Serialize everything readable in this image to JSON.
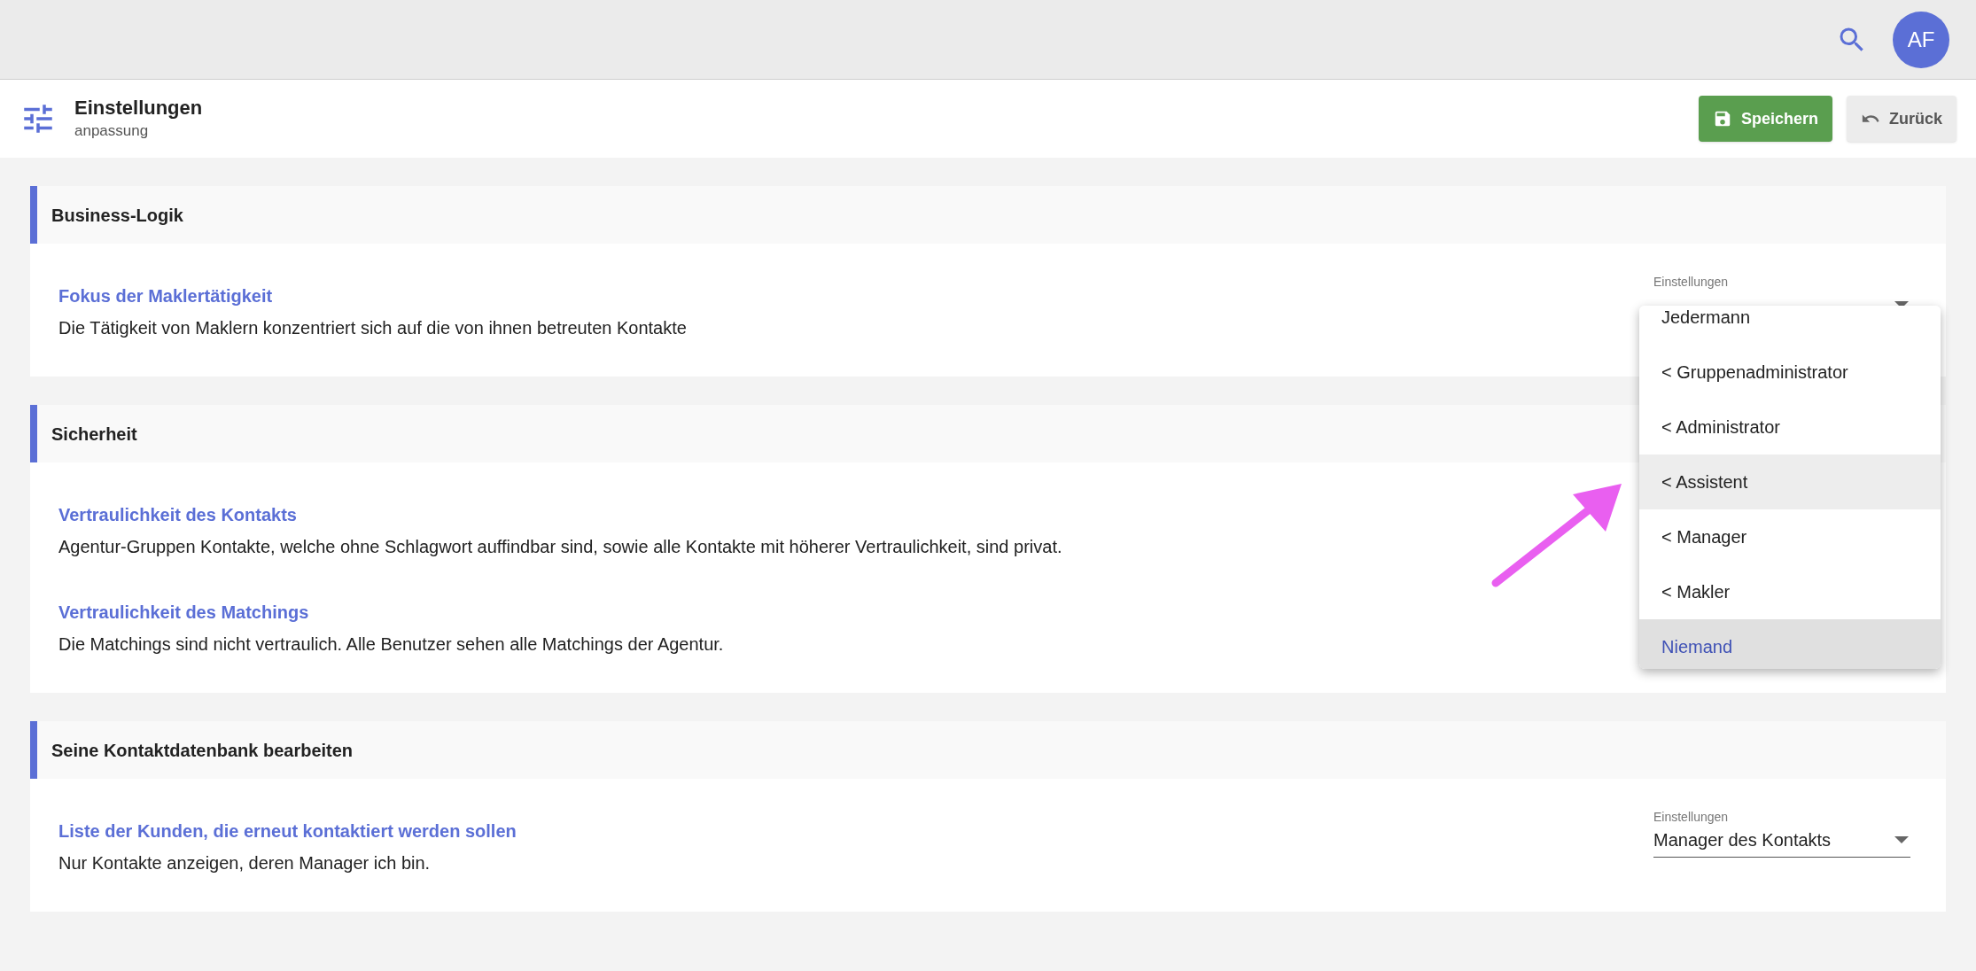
{
  "top_bar": {
    "avatar": "AF"
  },
  "header": {
    "title": "Einstellungen",
    "subtitle": "anpassung",
    "buttons": [
      {
        "kind": "save",
        "label": "Speichern"
      },
      {
        "kind": "back",
        "label": "Zurück"
      }
    ]
  },
  "sections": [
    {
      "title": "Business-Logik",
      "settings": [
        {
          "title": "Fokus der Maklertätigkeit",
          "description": "Die Tätigkeit von Maklern konzentriert sich auf die von ihnen betreuten Kontakte",
          "select": {
            "label": "Einstellungen"
          }
        }
      ]
    },
    {
      "title": "Sicherheit",
      "settings": [
        {
          "title": "Vertraulichkeit des Kontakts",
          "description": "Agentur-Gruppen Kontakte, welche ohne Schlagwort auffindbar sind, sowie alle Kontakte mit höherer Vertraulichkeit, sind privat."
        },
        {
          "title": "Vertraulichkeit des Matchings",
          "description": "Die Matchings sind nicht vertraulich. Alle Benutzer sehen alle Matchings der Agentur."
        }
      ]
    },
    {
      "title": "Seine Kontaktdatenbank bearbeiten",
      "settings": [
        {
          "title": "Liste der Kunden, die erneut kontaktiert werden sollen",
          "description": "Nur Kontakte anzeigen, deren Manager ich bin.",
          "select": {
            "label": "Einstellungen",
            "value": "Manager des Kontakts"
          }
        }
      ]
    }
  ],
  "dropdown_menu": {
    "items": [
      {
        "label": "Jedermann",
        "selected": false,
        "highlighted": false
      },
      {
        "label": "< Gruppenadministrator",
        "selected": false,
        "highlighted": false
      },
      {
        "label": "< Administrator",
        "selected": false,
        "highlighted": false
      },
      {
        "label": "< Assistent",
        "selected": false,
        "highlighted": true
      },
      {
        "label": "< Manager",
        "selected": false,
        "highlighted": false
      },
      {
        "label": "< Makler",
        "selected": false,
        "highlighted": false
      },
      {
        "label": "Niemand",
        "selected": true,
        "highlighted": false
      }
    ]
  }
}
